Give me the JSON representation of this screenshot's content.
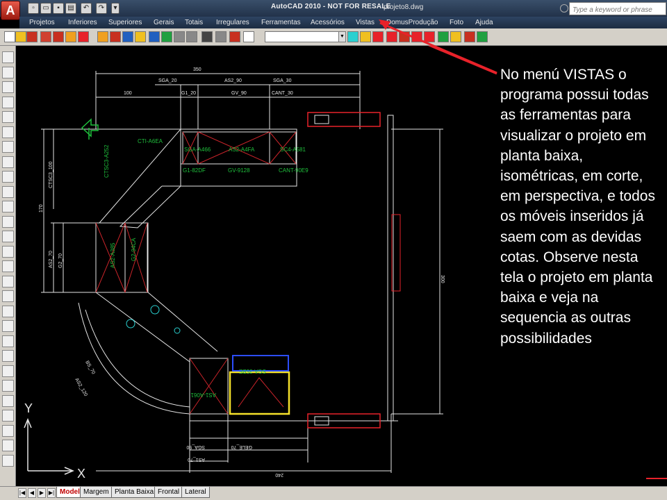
{
  "titlebar": {
    "app_title": "AutoCAD 2010 - NOT FOR RESALE",
    "file_name": "projeto8.dwg",
    "search_placeholder": "Type a keyword or phrase",
    "logo": "A"
  },
  "menu": [
    "Projetos",
    "Inferiores",
    "Superiores",
    "Gerais",
    "Totais",
    "Irregulares",
    "Ferramentas",
    "Acessórios",
    "Vistas",
    "DomusProdução",
    "Foto",
    "Ajuda"
  ],
  "layout_tabs": [
    "Model",
    "Margem",
    "Planta Baixa",
    "Frontal",
    "Lateral"
  ],
  "active_tab": "Model",
  "annotation": "No menú VISTAS o programa possui todas as ferramentas para visualizar o projeto em planta baixa, isométricas, em corte, em perspectiva, e todos os móveis inseridos já saem com as devidas cotas. Observe nesta tela o projeto em planta baixa e veja na sequencia as outras possibilidades",
  "drawing": {
    "dimensions": [
      "350",
      "SGA_20",
      "AS2_90",
      "SGA_30",
      "100",
      "G1_20",
      "GV_90",
      "CANT_30",
      "CTSC3_100",
      "170",
      "AS2_70",
      "G2_70",
      "AS2_120",
      "BS_70",
      "300",
      "SGA_90",
      "GELE_70",
      "AS1_70",
      "240"
    ],
    "module_labels": [
      "CTI-A6EA",
      "SGA-A466",
      "AS2-A4FA",
      "SC4-A581",
      "G1-82DF",
      "GV-9128",
      "CANT-90E9",
      "CTSC3-A252",
      "AS2-A385",
      "G2-94CA",
      "AS1-A061",
      "SGA-35BE"
    ],
    "ucs": {
      "y": "Y",
      "x": "X"
    }
  },
  "colors": {
    "accent_red": "#e8222a",
    "cad_white": "#e6e6e6",
    "cad_green": "#1fbf3c",
    "cad_red": "#c8242a",
    "cad_yellow": "#f5e12a",
    "cad_blue": "#2c4dff",
    "cad_cyan": "#2ad0d0"
  }
}
